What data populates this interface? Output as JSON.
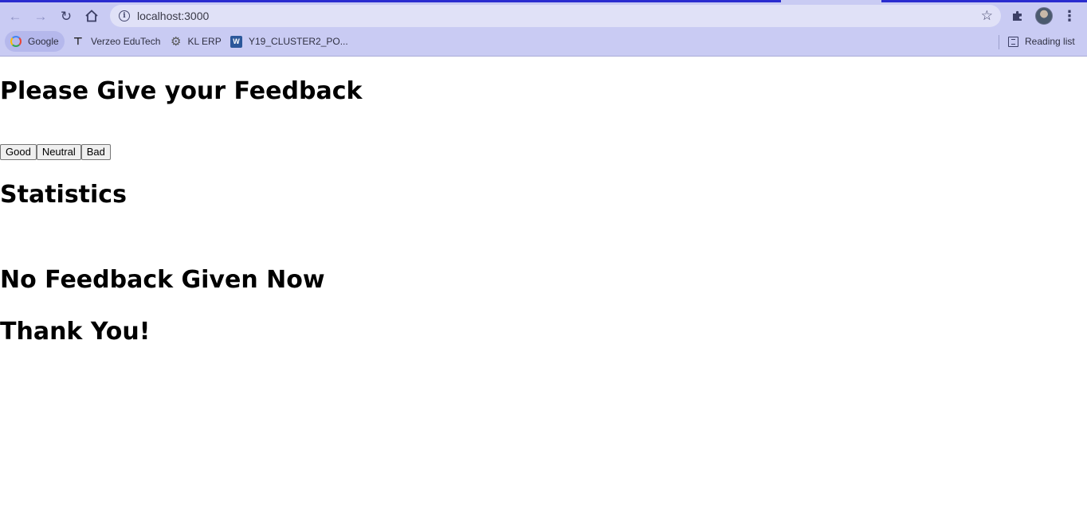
{
  "browser": {
    "url": "localhost:3000",
    "bookmarks": [
      {
        "label": "Google",
        "icon": "google-icon"
      },
      {
        "label": "Verzeo EduTech",
        "icon": "verzeo-icon"
      },
      {
        "label": "KL ERP",
        "icon": "gear-icon"
      },
      {
        "label": "Y19_CLUSTER2_PO...",
        "icon": "word-doc-icon"
      }
    ],
    "reading_list": "Reading list"
  },
  "page": {
    "title": "Please Give your Feedback",
    "buttons": {
      "good": "Good",
      "neutral": "Neutral",
      "bad": "Bad"
    },
    "statistics_heading": "Statistics",
    "no_feedback": "No Feedback Given Now",
    "thanks": "Thank You!"
  },
  "colors": {
    "browser_chrome": "#c9cbf3",
    "accent": "#2a2ccf",
    "page_background": "#ffffff"
  }
}
